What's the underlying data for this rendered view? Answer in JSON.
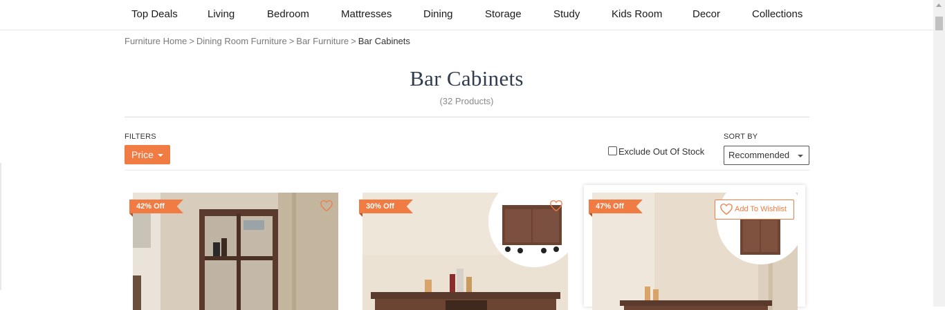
{
  "nav": {
    "items": [
      "Top Deals",
      "Living",
      "Bedroom",
      "Mattresses",
      "Dining",
      "Storage",
      "Study",
      "Kids Room",
      "Decor",
      "Collections"
    ]
  },
  "breadcrumb": {
    "items": [
      "Furniture Home",
      "Dining Room Furniture",
      "Bar Furniture"
    ],
    "separator": ">",
    "current": "Bar Cabinets"
  },
  "page": {
    "title": "Bar Cabinets",
    "count": "(32 Products)"
  },
  "filters": {
    "label": "FILTERS",
    "price_label": "Price",
    "exclude_label": "Exclude Out Of Stock",
    "exclude_checked": false
  },
  "sort": {
    "label": "SORT BY",
    "selected": "Recommended"
  },
  "products": [
    {
      "discount": "42% Off"
    },
    {
      "discount": "30% Off"
    },
    {
      "discount": "47% Off",
      "wishlist_label": "Add To Wishlist"
    }
  ],
  "colors": {
    "accent": "#f07b43",
    "title": "#2e3c4e"
  }
}
